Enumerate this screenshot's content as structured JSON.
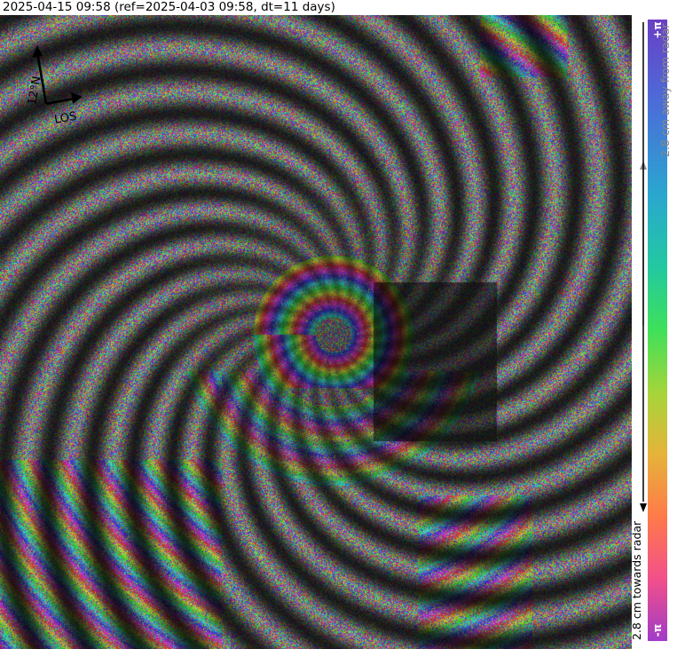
{
  "title": "2025-04-15 09:58 (ref=2025-04-03 09:58, dt=11 days)",
  "compass": {
    "north_label": "12°N",
    "los_label": "LOS"
  },
  "colorbar": {
    "top_label": "+π",
    "bottom_label": "-π",
    "away_label": "2.8 cm away from radar",
    "towards_label": "2.8 cm towards radar",
    "away_color": "#888888",
    "towards_color": "#000000"
  },
  "image": {
    "description_colors": [
      "#6a3fc4",
      "#4a6fd8",
      "#2aa6d0",
      "#3fe05a",
      "#e6b33a",
      "#ff7a4a",
      "#f2508a"
    ]
  }
}
